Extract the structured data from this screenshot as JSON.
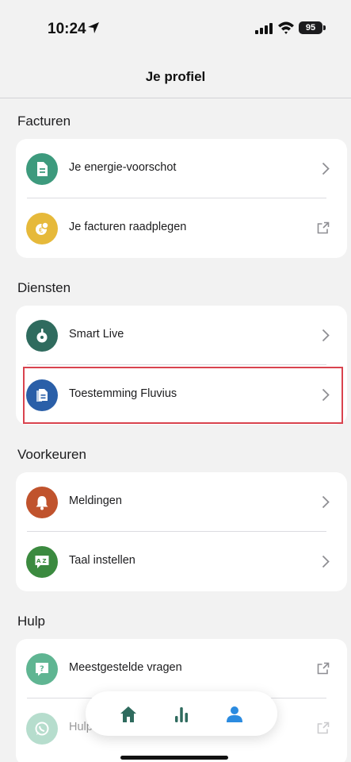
{
  "status_bar": {
    "time": "10:24",
    "battery": "95"
  },
  "header": {
    "title": "Je profiel"
  },
  "sections": [
    {
      "title": "Facturen",
      "items": [
        {
          "label": "Je energie-voorschot",
          "icon": "document-icon",
          "icon_color": "#3d9a7d",
          "action": "chevron"
        },
        {
          "label": "Je facturen raadplegen",
          "icon": "coins-icon",
          "icon_color": "#e6b93a",
          "action": "external-link"
        }
      ]
    },
    {
      "title": "Diensten",
      "items": [
        {
          "label": "Smart Live",
          "icon": "smart-meter-icon",
          "icon_color": "#2f6b5e",
          "action": "chevron"
        },
        {
          "label": "Toestemming Fluvius",
          "icon": "consent-document-icon",
          "icon_color": "#2a5fa8",
          "action": "chevron",
          "highlighted": true
        }
      ]
    },
    {
      "title": "Voorkeuren",
      "items": [
        {
          "label": "Meldingen",
          "icon": "bell-icon",
          "icon_color": "#c0532d",
          "action": "chevron"
        },
        {
          "label": "Taal instellen",
          "icon": "translate-icon",
          "icon_color": "#3b8a3f",
          "action": "chevron"
        }
      ]
    },
    {
      "title": "Hulp",
      "items": [
        {
          "label": "Meestgestelde vragen",
          "icon": "question-icon",
          "icon_color": "#5fb592",
          "action": "external-link"
        },
        {
          "label": "Hulp",
          "icon": "whatsapp-icon",
          "icon_color": "#5fb592",
          "action": "external-link"
        }
      ]
    }
  ],
  "tab_bar": {
    "tabs": [
      {
        "name": "home",
        "icon": "home-icon",
        "active": false
      },
      {
        "name": "stats",
        "icon": "bar-chart-icon",
        "active": false
      },
      {
        "name": "profile",
        "icon": "person-icon",
        "active": true
      }
    ],
    "active_color": "#2b8be0",
    "inactive_color": "#2f6b5e"
  },
  "colors": {
    "highlight_border": "#d9434e"
  }
}
